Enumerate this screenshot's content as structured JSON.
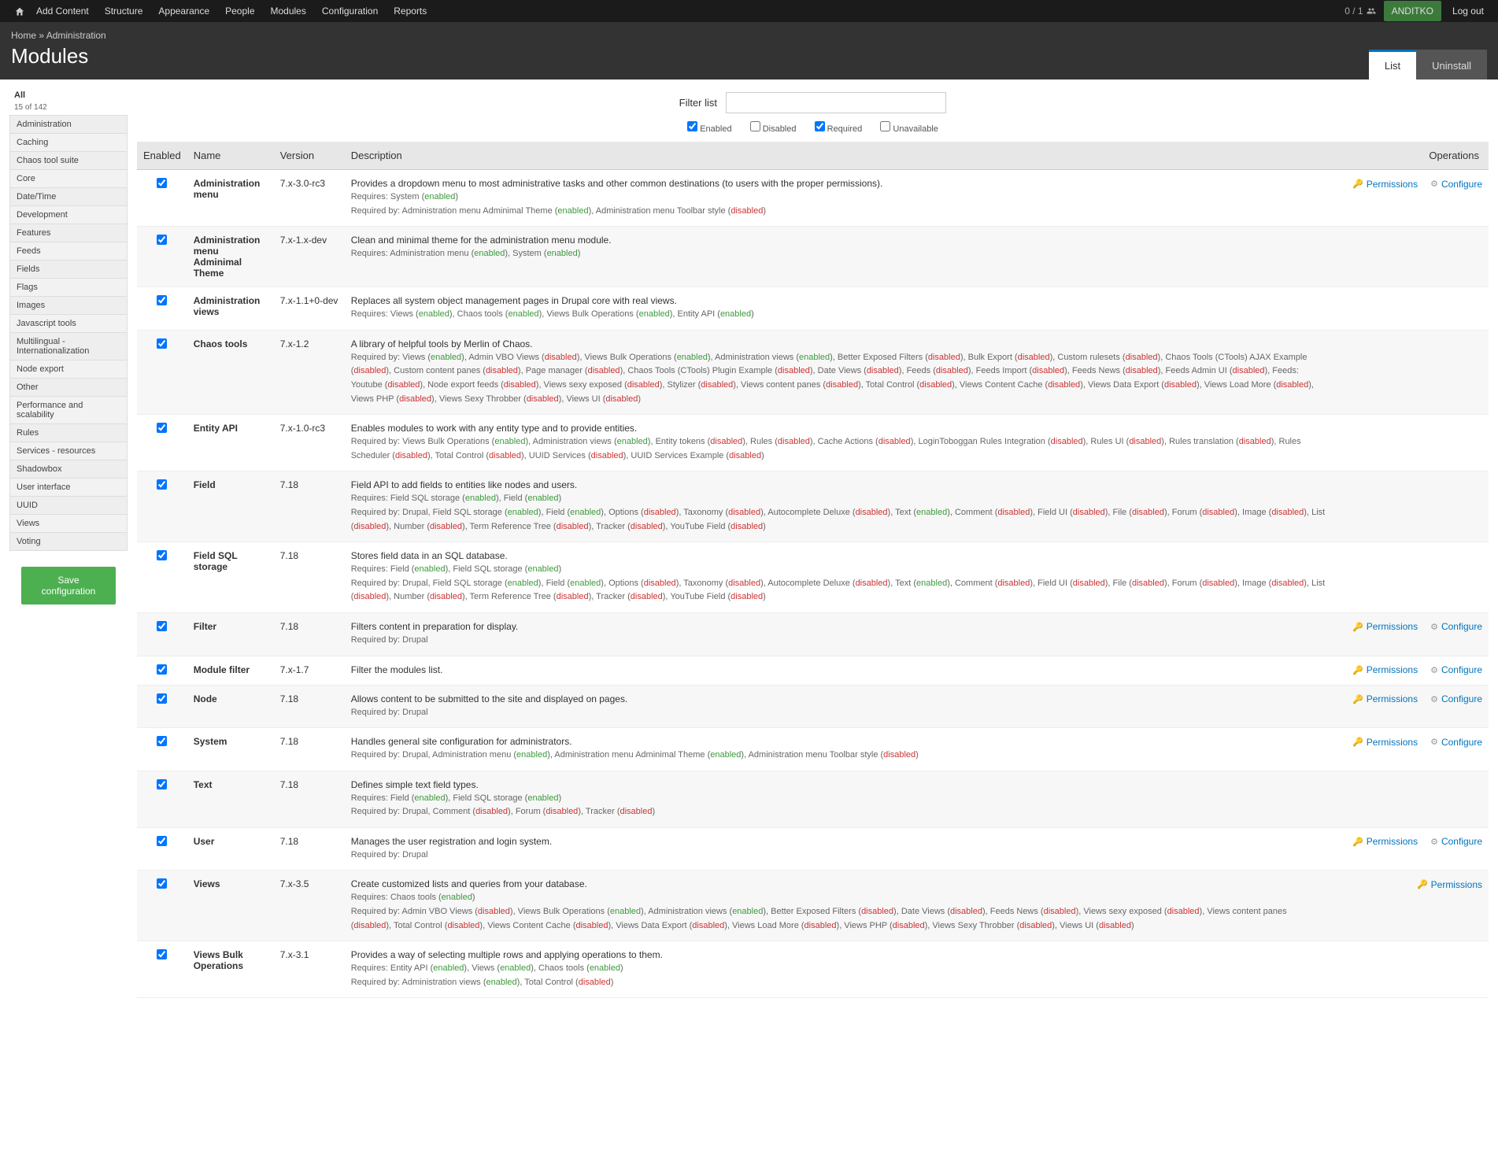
{
  "adminMenu": {
    "left": [
      "Add Content",
      "Structure",
      "Appearance",
      "People",
      "Modules",
      "Configuration",
      "Reports"
    ],
    "counter": "0 / 1",
    "user": "ANDITKO",
    "logout": "Log out"
  },
  "breadcrumb": {
    "home": "Home",
    "sep": " » ",
    "current": "Administration"
  },
  "pageTitle": "Modules",
  "tabs": {
    "list": "List",
    "uninstall": "Uninstall"
  },
  "sidebar": {
    "all": "All",
    "count": "15 of 142",
    "items": [
      "Administration",
      "Caching",
      "Chaos tool suite",
      "Core",
      "Date/Time",
      "Development",
      "Features",
      "Feeds",
      "Fields",
      "Flags",
      "Images",
      "Javascript tools",
      "Multilingual - Internationalization",
      "Node export",
      "Other",
      "Performance and scalability",
      "Rules",
      "Services - resources",
      "Shadowbox",
      "User interface",
      "UUID",
      "Views",
      "Voting"
    ],
    "saveBtn": "Save configuration"
  },
  "filter": {
    "label": "Filter list",
    "checks": {
      "enabled": "Enabled",
      "enabledChecked": true,
      "disabled": "Disabled",
      "disabledChecked": false,
      "required": "Required",
      "requiredChecked": true,
      "unavailable": "Unavailable",
      "unavailableChecked": false
    }
  },
  "tableHeaders": {
    "enabled": "Enabled",
    "name": "Name",
    "version": "Version",
    "description": "Description",
    "operations": "Operations"
  },
  "ops": {
    "permissions": "Permissions",
    "configure": "Configure"
  },
  "rows": [
    {
      "enabled": true,
      "name": "Administration menu",
      "version": "7.x-3.0-rc3",
      "desc": "Provides a dropdown menu to most administrative tasks and other common destinations (to users with the proper permissions).",
      "reqHtml": "Requires: System (<span class='enabled'>enabled</span>)<br>Required by: Administration menu Adminimal Theme (<span class='enabled'>enabled</span>), Administration menu Toolbar style (<span class='disabled'>disabled</span>)",
      "perm": true,
      "conf": true
    },
    {
      "enabled": true,
      "name": "Administration menu Adminimal Theme",
      "version": "7.x-1.x-dev",
      "desc": "Clean and minimal theme for the administration menu module.",
      "reqHtml": "Requires: Administration menu (<span class='enabled'>enabled</span>), System (<span class='enabled'>enabled</span>)",
      "perm": false,
      "conf": false
    },
    {
      "enabled": true,
      "name": "Administration views",
      "version": "7.x-1.1+0-dev",
      "desc": "Replaces all system object management pages in Drupal core with real views.",
      "reqHtml": "Requires: Views (<span class='enabled'>enabled</span>), Chaos tools (<span class='enabled'>enabled</span>), Views Bulk Operations (<span class='enabled'>enabled</span>), Entity API (<span class='enabled'>enabled</span>)",
      "perm": false,
      "conf": false
    },
    {
      "enabled": true,
      "name": "Chaos tools",
      "version": "7.x-1.2",
      "desc": "A library of helpful tools by Merlin of Chaos.",
      "reqHtml": "Required by: Views (<span class='enabled'>enabled</span>), Admin VBO Views (<span class='disabled'>disabled</span>), Views Bulk Operations (<span class='enabled'>enabled</span>), Administration views (<span class='enabled'>enabled</span>), Better Exposed Filters (<span class='disabled'>disabled</span>), Bulk Export (<span class='disabled'>disabled</span>), Custom rulesets (<span class='disabled'>disabled</span>), Chaos Tools (CTools) AJAX Example (<span class='disabled'>disabled</span>), Custom content panes (<span class='disabled'>disabled</span>), Page manager (<span class='disabled'>disabled</span>), Chaos Tools (CTools) Plugin Example (<span class='disabled'>disabled</span>), Date Views (<span class='disabled'>disabled</span>), Feeds (<span class='disabled'>disabled</span>), Feeds Import (<span class='disabled'>disabled</span>), Feeds News (<span class='disabled'>disabled</span>), Feeds Admin UI (<span class='disabled'>disabled</span>), Feeds: Youtube (<span class='disabled'>disabled</span>), Node export feeds (<span class='disabled'>disabled</span>), Views sexy exposed (<span class='disabled'>disabled</span>), Stylizer (<span class='disabled'>disabled</span>), Views content panes (<span class='disabled'>disabled</span>), Total Control (<span class='disabled'>disabled</span>), Views Content Cache (<span class='disabled'>disabled</span>), Views Data Export (<span class='disabled'>disabled</span>), Views Load More (<span class='disabled'>disabled</span>), Views PHP (<span class='disabled'>disabled</span>), Views Sexy Throbber (<span class='disabled'>disabled</span>), Views UI (<span class='disabled'>disabled</span>)",
      "perm": false,
      "conf": false
    },
    {
      "enabled": true,
      "name": "Entity API",
      "version": "7.x-1.0-rc3",
      "desc": "Enables modules to work with any entity type and to provide entities.",
      "reqHtml": "Required by: Views Bulk Operations (<span class='enabled'>enabled</span>), Administration views (<span class='enabled'>enabled</span>), Entity tokens (<span class='disabled'>disabled</span>), Rules (<span class='disabled'>disabled</span>), Cache Actions (<span class='disabled'>disabled</span>), LoginToboggan Rules Integration (<span class='disabled'>disabled</span>), Rules UI (<span class='disabled'>disabled</span>), Rules translation (<span class='disabled'>disabled</span>), Rules Scheduler (<span class='disabled'>disabled</span>), Total Control (<span class='disabled'>disabled</span>), UUID Services (<span class='disabled'>disabled</span>), UUID Services Example (<span class='disabled'>disabled</span>)",
      "perm": false,
      "conf": false
    },
    {
      "enabled": true,
      "name": "Field",
      "version": "7.18",
      "desc": "Field API to add fields to entities like nodes and users.",
      "reqHtml": "Requires: Field SQL storage (<span class='enabled'>enabled</span>), Field (<span class='enabled'>enabled</span>)<br>Required by: Drupal, Field SQL storage (<span class='enabled'>enabled</span>), Field (<span class='enabled'>enabled</span>), Options (<span class='disabled'>disabled</span>), Taxonomy (<span class='disabled'>disabled</span>), Autocomplete Deluxe (<span class='disabled'>disabled</span>), Text (<span class='enabled'>enabled</span>), Comment (<span class='disabled'>disabled</span>), Field UI (<span class='disabled'>disabled</span>), File (<span class='disabled'>disabled</span>), Forum (<span class='disabled'>disabled</span>), Image (<span class='disabled'>disabled</span>), List (<span class='disabled'>disabled</span>), Number (<span class='disabled'>disabled</span>), Term Reference Tree (<span class='disabled'>disabled</span>), Tracker (<span class='disabled'>disabled</span>), YouTube Field (<span class='disabled'>disabled</span>)",
      "perm": false,
      "conf": false
    },
    {
      "enabled": true,
      "name": "Field SQL storage",
      "version": "7.18",
      "desc": "Stores field data in an SQL database.",
      "reqHtml": "Requires: Field (<span class='enabled'>enabled</span>), Field SQL storage (<span class='enabled'>enabled</span>)<br>Required by: Drupal, Field SQL storage (<span class='enabled'>enabled</span>), Field (<span class='enabled'>enabled</span>), Options (<span class='disabled'>disabled</span>), Taxonomy (<span class='disabled'>disabled</span>), Autocomplete Deluxe (<span class='disabled'>disabled</span>), Text (<span class='enabled'>enabled</span>), Comment (<span class='disabled'>disabled</span>), Field UI (<span class='disabled'>disabled</span>), File (<span class='disabled'>disabled</span>), Forum (<span class='disabled'>disabled</span>), Image (<span class='disabled'>disabled</span>), List (<span class='disabled'>disabled</span>), Number (<span class='disabled'>disabled</span>), Term Reference Tree (<span class='disabled'>disabled</span>), Tracker (<span class='disabled'>disabled</span>), YouTube Field (<span class='disabled'>disabled</span>)",
      "perm": false,
      "conf": false
    },
    {
      "enabled": true,
      "name": "Filter",
      "version": "7.18",
      "desc": "Filters content in preparation for display.",
      "reqHtml": "Required by: Drupal",
      "perm": true,
      "conf": true
    },
    {
      "enabled": true,
      "name": "Module filter",
      "version": "7.x-1.7",
      "desc": "Filter the modules list.",
      "reqHtml": "",
      "perm": true,
      "conf": true
    },
    {
      "enabled": true,
      "name": "Node",
      "version": "7.18",
      "desc": "Allows content to be submitted to the site and displayed on pages.",
      "reqHtml": "Required by: Drupal",
      "perm": true,
      "conf": true
    },
    {
      "enabled": true,
      "name": "System",
      "version": "7.18",
      "desc": "Handles general site configuration for administrators.",
      "reqHtml": "Required by: Drupal, Administration menu (<span class='enabled'>enabled</span>), Administration menu Adminimal Theme (<span class='enabled'>enabled</span>), Administration menu Toolbar style (<span class='disabled'>disabled</span>)",
      "perm": true,
      "conf": true
    },
    {
      "enabled": true,
      "name": "Text",
      "version": "7.18",
      "desc": "Defines simple text field types.",
      "reqHtml": "Requires: Field (<span class='enabled'>enabled</span>), Field SQL storage (<span class='enabled'>enabled</span>)<br>Required by: Drupal, Comment (<span class='disabled'>disabled</span>), Forum (<span class='disabled'>disabled</span>), Tracker (<span class='disabled'>disabled</span>)",
      "perm": false,
      "conf": false
    },
    {
      "enabled": true,
      "name": "User",
      "version": "7.18",
      "desc": "Manages the user registration and login system.",
      "reqHtml": "Required by: Drupal",
      "perm": true,
      "conf": true
    },
    {
      "enabled": true,
      "name": "Views",
      "version": "7.x-3.5",
      "desc": "Create customized lists and queries from your database.",
      "reqHtml": "Requires: Chaos tools (<span class='enabled'>enabled</span>)<br>Required by: Admin VBO Views (<span class='disabled'>disabled</span>), Views Bulk Operations (<span class='enabled'>enabled</span>), Administration views (<span class='enabled'>enabled</span>), Better Exposed Filters (<span class='disabled'>disabled</span>), Date Views (<span class='disabled'>disabled</span>), Feeds News (<span class='disabled'>disabled</span>), Views sexy exposed (<span class='disabled'>disabled</span>), Views content panes (<span class='disabled'>disabled</span>), Total Control (<span class='disabled'>disabled</span>), Views Content Cache (<span class='disabled'>disabled</span>), Views Data Export (<span class='disabled'>disabled</span>), Views Load More (<span class='disabled'>disabled</span>), Views PHP (<span class='disabled'>disabled</span>), Views Sexy Throbber (<span class='disabled'>disabled</span>), Views UI (<span class='disabled'>disabled</span>)",
      "perm": true,
      "conf": false
    },
    {
      "enabled": true,
      "name": "Views Bulk Operations",
      "version": "7.x-3.1",
      "desc": "Provides a way of selecting multiple rows and applying operations to them.",
      "reqHtml": "Requires: Entity API (<span class='enabled'>enabled</span>), Views (<span class='enabled'>enabled</span>), Chaos tools (<span class='enabled'>enabled</span>)<br>Required by: Administration views (<span class='enabled'>enabled</span>), Total Control (<span class='disabled'>disabled</span>)",
      "perm": false,
      "conf": false
    }
  ]
}
